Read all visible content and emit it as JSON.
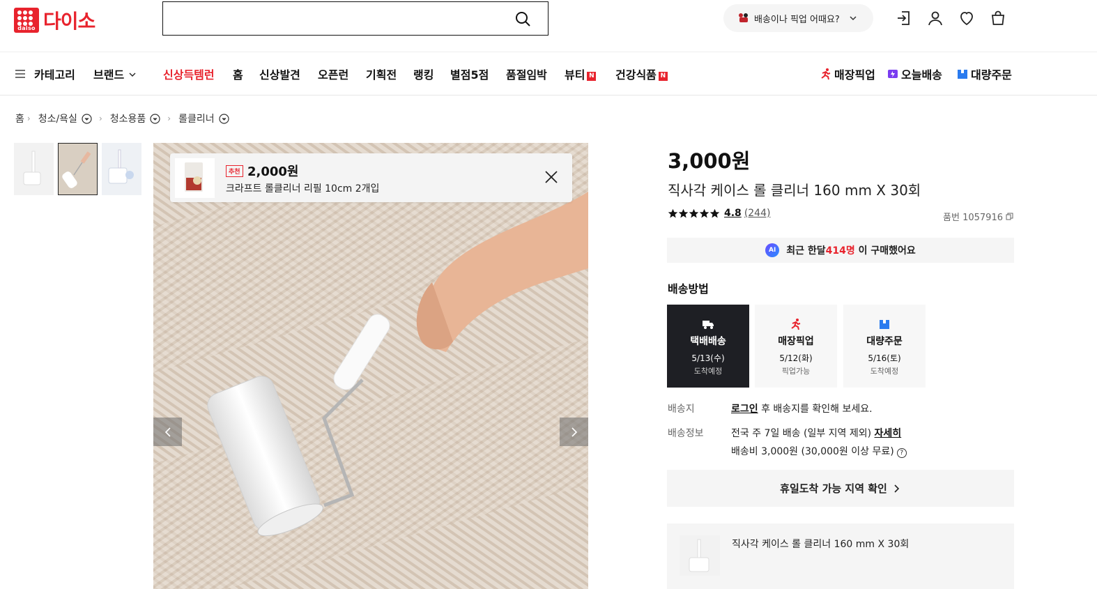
{
  "brand": {
    "logo_sub": "daiso",
    "logo_text": "다이소",
    "color": "#e8232d"
  },
  "search": {
    "placeholder": "",
    "value": ""
  },
  "header": {
    "delivery_pill": "배송이나 픽업 어때요?",
    "icons": [
      "login-icon",
      "user-icon",
      "heart-icon",
      "bag-icon"
    ]
  },
  "gnb": {
    "category": "카테고리",
    "brand": "브랜드",
    "items": [
      "신상득템런",
      "홈",
      "신상발견",
      "오픈런",
      "기획전",
      "랭킹",
      "별점5점",
      "품절임박",
      "뷰티",
      "건강식품"
    ],
    "new_badge": "N",
    "services": [
      "매장픽업",
      "오늘배송",
      "대량주문"
    ]
  },
  "breadcrumb": [
    "홈",
    "청소/욕실",
    "청소용품",
    "롤클리너"
  ],
  "recommend": {
    "tag": "추천",
    "price": "2,000원",
    "name": "크라프트 롤클리너 리필 10cm 2개입"
  },
  "product": {
    "price": "3,000원",
    "title": "직사각 케이스 롤 클리너 160 mm X 30회",
    "rating": "4.8",
    "review_count": "(244)",
    "sku_label": "품번 1057916",
    "ai_badge": "AI",
    "ai_pre": "최근 한달 ",
    "ai_count": "414명",
    "ai_post": " 이 구매했어요"
  },
  "shipping": {
    "title": "배송방법",
    "options": [
      {
        "name": "택배배송",
        "date": "5/13(수)",
        "status": "도착예정"
      },
      {
        "name": "매장픽업",
        "date": "5/12(화)",
        "status": "픽업가능"
      },
      {
        "name": "대량주문",
        "date": "5/16(토)",
        "status": "도착예정"
      }
    ],
    "dest_label": "배송지",
    "dest_login": "로그인",
    "dest_text": " 후 배송지를 확인해 보세요.",
    "info_label": "배송정보",
    "info_text": "전국 주 7일 배송 (일부 지역 제외) ",
    "info_link": "자세히",
    "fee_text": "배송비 3,000원 (30,000원 이상 무료)",
    "fee_help": "?",
    "holiday_btn": "휴일도착 가능 지역 확인"
  },
  "option": {
    "name": "직사각 케이스 롤 클리너 160 mm X 30회"
  },
  "colors": {
    "accent": "#e8232d",
    "dark_card": "#1e1f24",
    "panel_bg": "#f5f5f5"
  }
}
